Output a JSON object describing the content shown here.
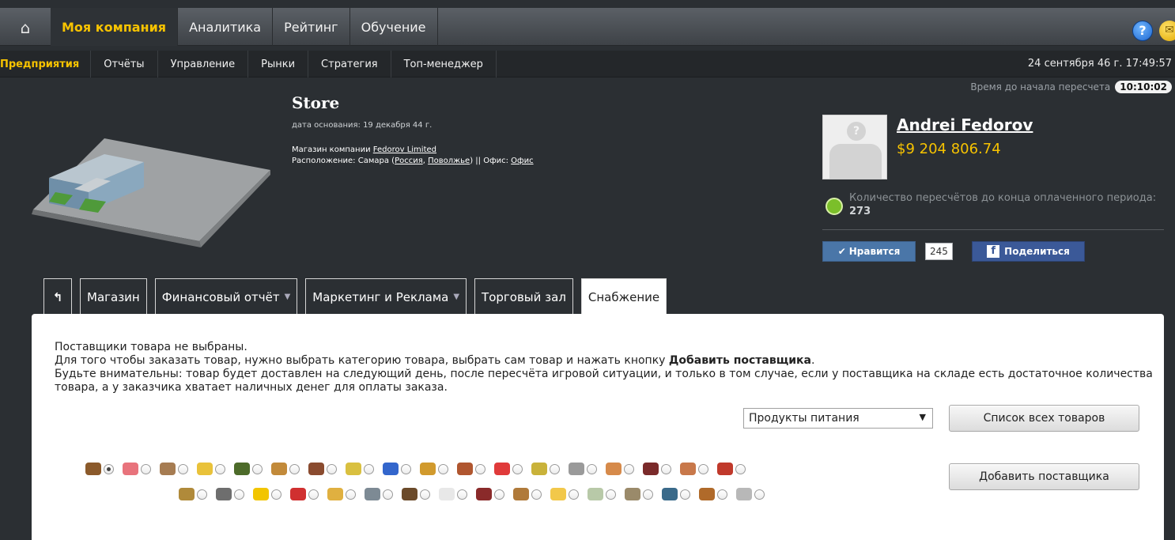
{
  "topnav": {
    "items": [
      "Моя компания",
      "Аналитика",
      "Рейтинг",
      "Обучение"
    ]
  },
  "subnav": {
    "items": [
      "Предприятия",
      "Отчёты",
      "Управление",
      "Рынки",
      "Стратегия",
      "Топ-менеджер"
    ],
    "datetime": "24 сентября 46 г.  17:49:57"
  },
  "recalc": {
    "label": "Время до начала пересчета",
    "timer": "10:10:02"
  },
  "unit": {
    "title": "Store",
    "founded": "дата основания: 19 декабря 44 г.",
    "owner_prefix": "Магазин компании ",
    "owner_link": "Fedorov Limited",
    "location_prefix": "Расположение: Самара (",
    "country_link": "Россия",
    "comma": ", ",
    "region_link": "Поволжье",
    "office_prefix": ") || Офис: ",
    "office_link": "Офис"
  },
  "player": {
    "name": "Andrei Fedorov",
    "money": "$9 204 806.74",
    "avatar_placeholder": "?",
    "recount_text": "Количество пересчётов до конца оплаченного периода: ",
    "recount_value": "273"
  },
  "social": {
    "like_label": "Нравится",
    "like_count": "245",
    "share_label": "Поделиться",
    "fb_letter": "f",
    "check": "✔"
  },
  "tabs": {
    "back": "↰",
    "items": [
      "Магазин",
      "Финансовый отчёт",
      "Маркетинг и Реклама",
      "Торговый зал",
      "Снабжение"
    ],
    "caret": "▼"
  },
  "supply": {
    "line1": "Поставщики товара не выбраны.",
    "line2_prefix": "Для того чтобы заказать товар, нужно выбрать категорию товара, выбрать сам товар и нажать кнопку ",
    "line2_bold": "Добавить поставщика",
    "line2_suffix": ".",
    "line3": "Будьте внимательны: товар будет доставлен на следующий день, после пересчёта игровой ситуации, и только в том случае, если у поставщика на складе есть достаточное количества товара, а у заказчика хватает наличных денег для оплаты заказа.",
    "category_value": "Продукты питания",
    "select_arrow": "▼",
    "btn_all": "Список всех товаров",
    "btn_add": "Добавить поставщика"
  },
  "products": {
    "row1_colors": [
      "#8b5a2b",
      "#e8737c",
      "#a67c52",
      "#e9c23a",
      "#4d6b2a",
      "#c28a3a",
      "#8a4b2f",
      "#d9c040",
      "#3366cc",
      "#d19a2d",
      "#b0562f",
      "#e03a3a",
      "#c9b23a",
      "#9a9a9a",
      "#d68a4a",
      "#7a2a2a",
      "#c8784a",
      "#c0392b"
    ],
    "row2_colors": [
      "#b08a3a",
      "#6e6e6e",
      "#f2c500",
      "#d03030",
      "#e0b040",
      "#7d8a94",
      "#6b4a2a",
      "#e8e8e8",
      "#8a2a2a",
      "#b07a3a",
      "#f2c84a",
      "#b8c9a8",
      "#9a8a6a",
      "#3a6a8a",
      "#b06a2a",
      "#b8b8b8"
    ]
  },
  "colors": {
    "accent": "#f7c300",
    "link_white": "#ffffff",
    "like_blue": "#4a76a8",
    "fb_blue": "#3b5998"
  }
}
